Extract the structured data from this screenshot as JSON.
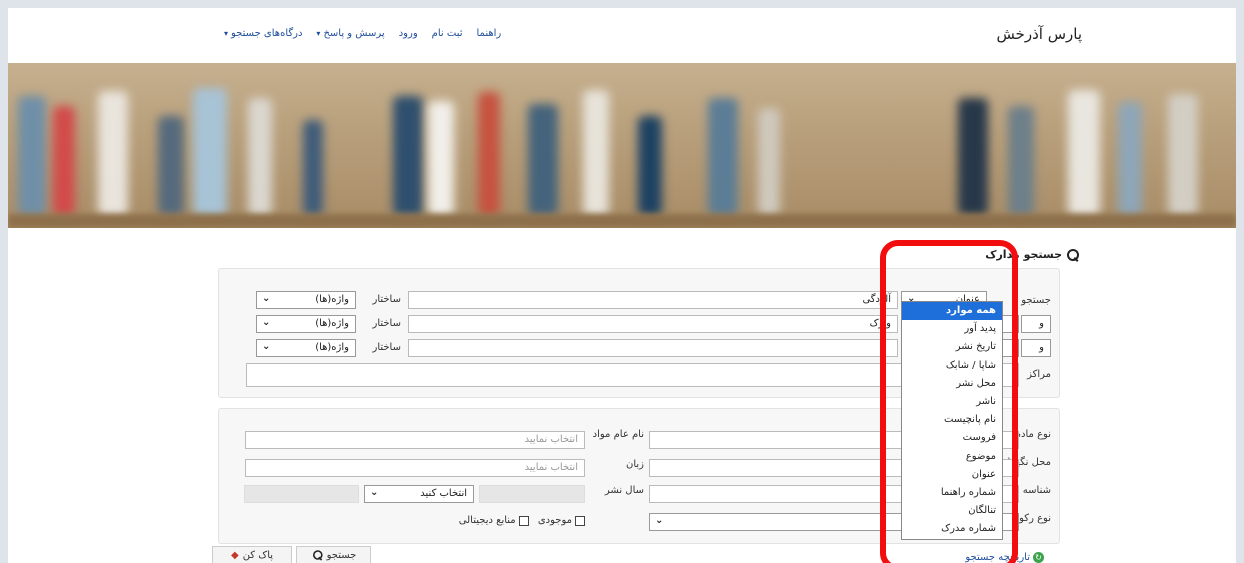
{
  "header": {
    "brand": "پارس آذرخش",
    "nav": [
      {
        "label": "درگاه‌های جستجو",
        "caret": "▾"
      },
      {
        "label": "پرسش و پاسخ",
        "caret": "▾"
      },
      {
        "label": "ورود",
        "caret": ""
      },
      {
        "label": "ثبت نام",
        "caret": ""
      },
      {
        "label": "راهنما",
        "caret": ""
      }
    ]
  },
  "search": {
    "title": "جستجو مدارک",
    "row_label": "جستجو",
    "operator": "و",
    "centers_label": "مراکز",
    "field_select_value": "عنوان",
    "terms": [
      "آلودگی",
      "وارک",
      ""
    ],
    "structure_label": "ساختار",
    "structure_value": "واژه(ها)"
  },
  "dropdown": {
    "options": [
      "همه موارد",
      "پدید آور",
      "تاریخ نشر",
      "شاپا / شابک",
      "محل نشر",
      "ناشر",
      "نام پانچیست",
      "فروست",
      "موضوع",
      "عنوان",
      "شماره راهنما",
      "تنالگان",
      "شماره مدرک"
    ],
    "selected_index": 0
  },
  "filters": {
    "material_type_label": "نوع ماده",
    "location_label": "محل نگهداری",
    "id_label": "شناسه بازیابی",
    "record_type_label": "نوع رکورد",
    "general_material_label": "نام عام مواد",
    "language_label": "زبان",
    "year_label": "سال نشر",
    "placeholder_select": "انتخاب نمایید",
    "choose": "انتخاب کنید",
    "availability": "موجودی",
    "digital": "منابع دیجیتالی"
  },
  "actions": {
    "search": "جستجو",
    "clear": "پاک کن",
    "history": "تاریخچه جستجو"
  }
}
